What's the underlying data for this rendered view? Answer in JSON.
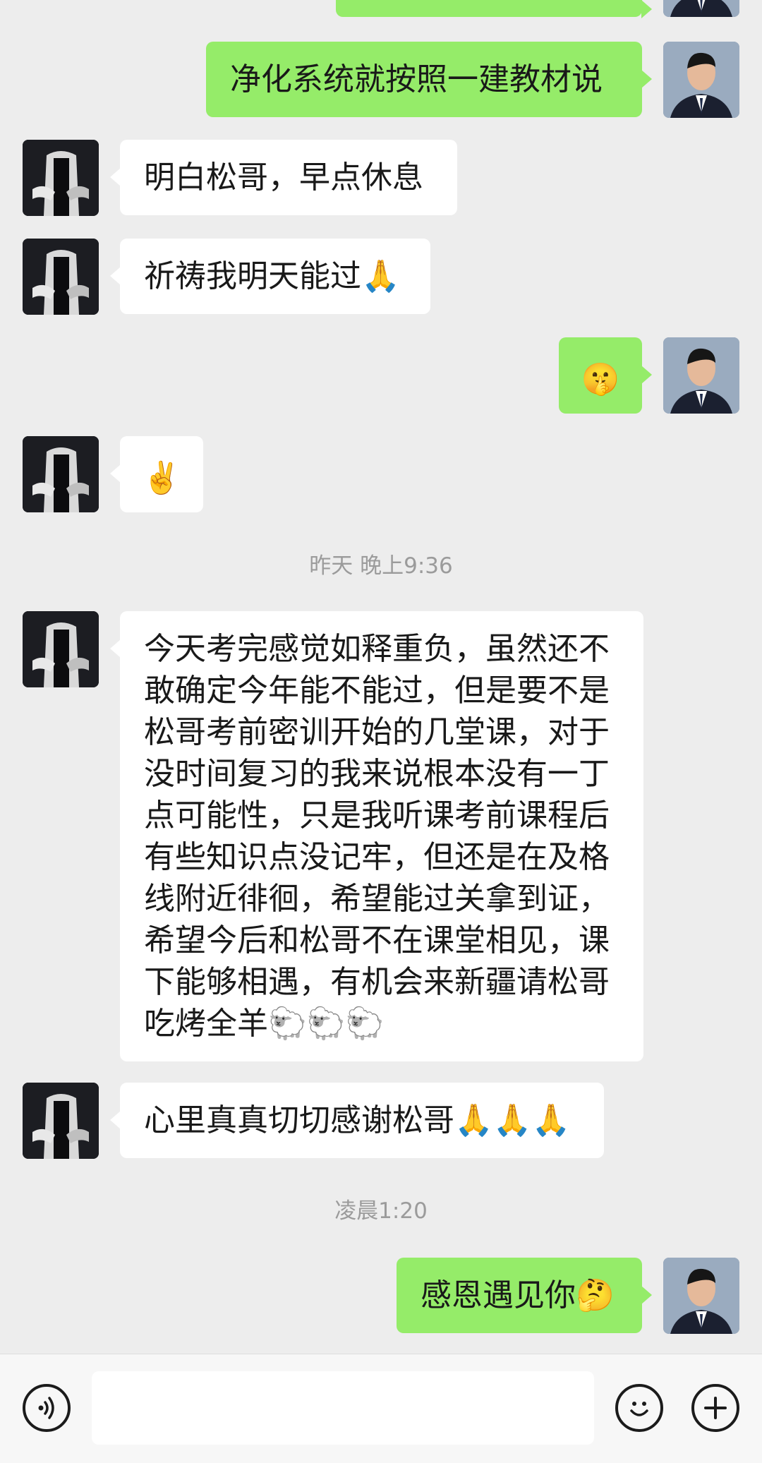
{
  "messages": {
    "m1": "净化系统就按照一建教材说",
    "m2": "明白松哥，早点休息",
    "m3": "祈祷我明天能过",
    "m3_emoji": "🙏",
    "m4_emoji": "🤫",
    "m5_emoji": "✌️",
    "m6": "今天考完感觉如释重负，虽然还不敢确定今年能不能过，但是要不是松哥考前密训开始的几堂课，对于没时间复习的我来说根本没有一丁点可能性，只是我听课考前课程后有些知识点没记牢，但还是在及格线附近徘徊，希望能过关拿到证，希望今后和松哥不在课堂相见，课下能够相遇，有机会来新疆请松哥吃烤全羊",
    "m6_emoji": "🐑🐑🐑",
    "m7": "心里真真切切感谢松哥",
    "m7_emoji": "🙏🙏🙏",
    "m8": "感恩遇见你",
    "m8_emoji": "🤔"
  },
  "timestamps": {
    "t1": "昨天 晚上9:36",
    "t2": "凌晨1:20"
  },
  "toolbar": {
    "voice_icon": "voice-icon",
    "emoji_icon": "emoji-icon",
    "plus_icon": "plus-icon"
  },
  "colors": {
    "self_bubble": "#95ec69",
    "other_bubble": "#ffffff",
    "background": "#ededed"
  }
}
